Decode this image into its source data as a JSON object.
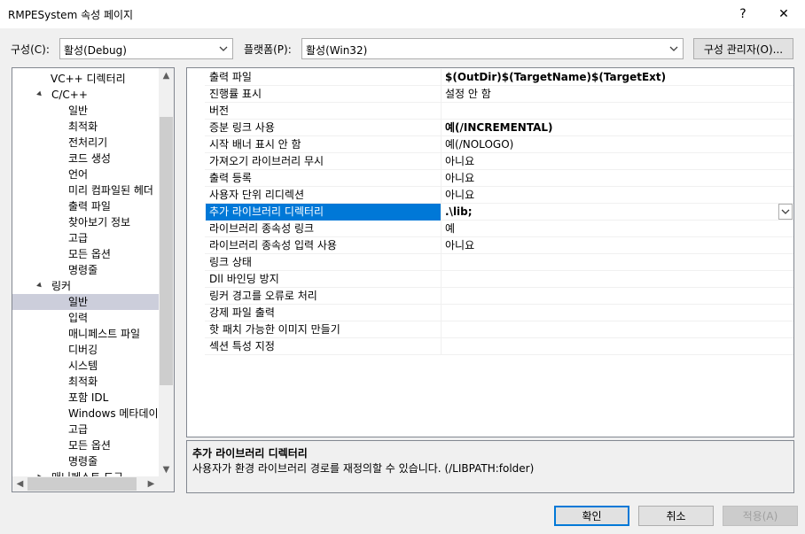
{
  "window": {
    "title": "RMPESystem 속성 페이지",
    "help_glyph": "?",
    "close_glyph": "✕"
  },
  "toolbar": {
    "config_label": "구성(C):",
    "config_value": "활성(Debug)",
    "platform_label": "플랫폼(P):",
    "platform_value": "활성(Win32)",
    "config_manager_label": "구성 관리자(O)..."
  },
  "tree": {
    "items": [
      {
        "label": "VC++ 디렉터리",
        "level": 1,
        "arrow": ""
      },
      {
        "label": "C/C++",
        "level": 0,
        "arrow": "expanded"
      },
      {
        "label": "일반",
        "level": 2,
        "arrow": ""
      },
      {
        "label": "최적화",
        "level": 2,
        "arrow": ""
      },
      {
        "label": "전처리기",
        "level": 2,
        "arrow": ""
      },
      {
        "label": "코드 생성",
        "level": 2,
        "arrow": ""
      },
      {
        "label": "언어",
        "level": 2,
        "arrow": ""
      },
      {
        "label": "미리 컴파일된 헤더",
        "level": 2,
        "arrow": ""
      },
      {
        "label": "출력 파일",
        "level": 2,
        "arrow": ""
      },
      {
        "label": "찾아보기 정보",
        "level": 2,
        "arrow": ""
      },
      {
        "label": "고급",
        "level": 2,
        "arrow": ""
      },
      {
        "label": "모든 옵션",
        "level": 2,
        "arrow": ""
      },
      {
        "label": "명령줄",
        "level": 2,
        "arrow": ""
      },
      {
        "label": "링커",
        "level": 0,
        "arrow": "expanded"
      },
      {
        "label": "일반",
        "level": 2,
        "arrow": "",
        "selected": true
      },
      {
        "label": "입력",
        "level": 2,
        "arrow": ""
      },
      {
        "label": "매니페스트 파일",
        "level": 2,
        "arrow": ""
      },
      {
        "label": "디버깅",
        "level": 2,
        "arrow": ""
      },
      {
        "label": "시스템",
        "level": 2,
        "arrow": ""
      },
      {
        "label": "최적화",
        "level": 2,
        "arrow": ""
      },
      {
        "label": "포함 IDL",
        "level": 2,
        "arrow": ""
      },
      {
        "label": "Windows 메타데이",
        "level": 2,
        "arrow": ""
      },
      {
        "label": "고급",
        "level": 2,
        "arrow": ""
      },
      {
        "label": "모든 옵션",
        "level": 2,
        "arrow": ""
      },
      {
        "label": "명령줄",
        "level": 2,
        "arrow": ""
      },
      {
        "label": "매니페스트 도구",
        "level": 0,
        "arrow": "collapsed"
      }
    ]
  },
  "properties": [
    {
      "name": "출력 파일",
      "value": "$(OutDir)$(TargetName)$(TargetExt)",
      "bold": true
    },
    {
      "name": "진행률 표시",
      "value": "설정 안 함"
    },
    {
      "name": "버전",
      "value": ""
    },
    {
      "name": "증분 링크 사용",
      "value": "예(/INCREMENTAL)",
      "bold": true
    },
    {
      "name": "시작 배너 표시 안 함",
      "value": "예(/NOLOGO)"
    },
    {
      "name": "가져오기 라이브러리 무시",
      "value": "아니요"
    },
    {
      "name": "출력 등록",
      "value": "아니요"
    },
    {
      "name": "사용자 단위 리디렉션",
      "value": "아니요"
    },
    {
      "name": "추가 라이브러리 디렉터리",
      "value": ".\\lib;",
      "selected": true,
      "bold": true
    },
    {
      "name": "라이브러리 종속성 링크",
      "value": "예"
    },
    {
      "name": "라이브러리 종속성 입력 사용",
      "value": "아니요"
    },
    {
      "name": "링크 상태",
      "value": ""
    },
    {
      "name": "Dll 바인딩 방지",
      "value": ""
    },
    {
      "name": "링커 경고를 오류로 처리",
      "value": ""
    },
    {
      "name": "강제 파일 출력",
      "value": ""
    },
    {
      "name": "핫 패치 가능한 이미지 만들기",
      "value": ""
    },
    {
      "name": "섹션 특성 지정",
      "value": ""
    }
  ],
  "description": {
    "title": "추가 라이브러리 디렉터리",
    "text": "사용자가 환경 라이브러리 경로를 재정의할 수 있습니다. (/LIBPATH:folder)"
  },
  "buttons": {
    "ok": "확인",
    "cancel": "취소",
    "apply": "적용(A)"
  },
  "colors": {
    "selection": "#0078d7",
    "tree_selection": "#cccedb",
    "dialog_bg": "#f0f0f0",
    "disabled_text": "#a0a0a0"
  }
}
